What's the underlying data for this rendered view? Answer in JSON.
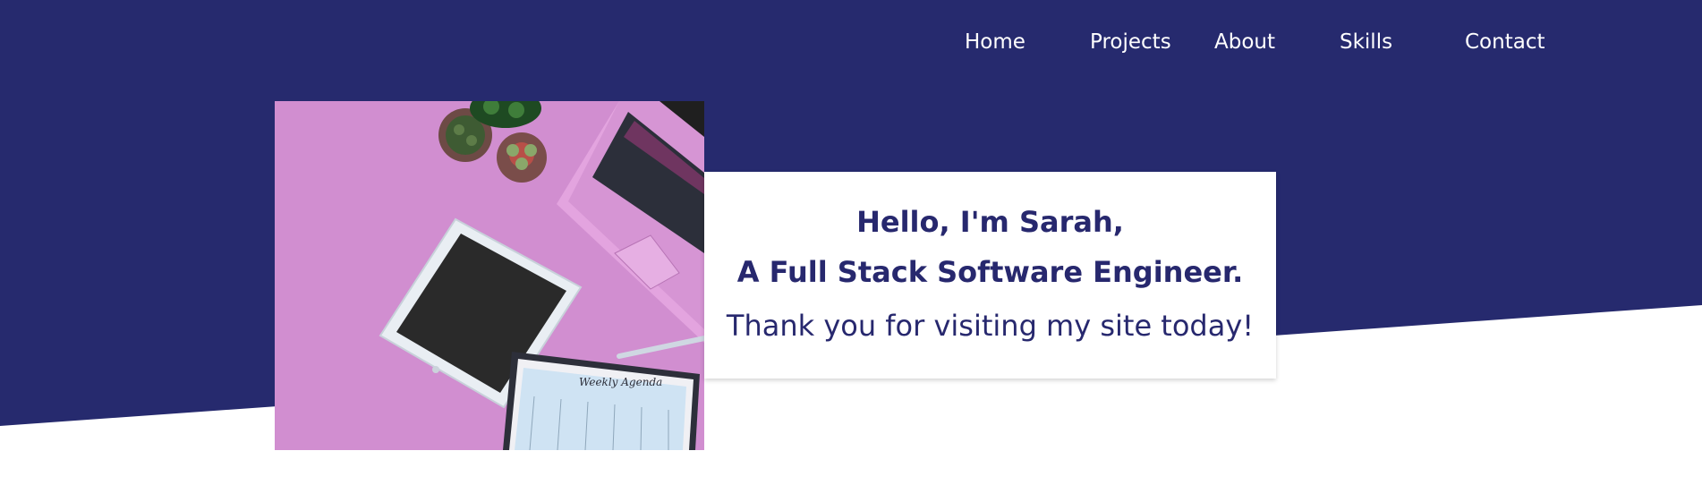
{
  "colors": {
    "hero_background": "#262a6e",
    "nav_text": "#ffffff",
    "card_text": "#27286e",
    "card_background": "#ffffff",
    "image_background": "#d18ed0"
  },
  "nav": {
    "items": [
      {
        "label": "Home",
        "icon": ""
      },
      {
        "label": "Projects",
        "icon": ""
      },
      {
        "label": "About",
        "icon": ""
      },
      {
        "label": "Skills",
        "icon": ""
      },
      {
        "label": "Contact",
        "icon": ""
      }
    ]
  },
  "hero": {
    "image_alt": "laptop, tablet, succulents and weekly agenda on pink desk",
    "image_notepad_text": "Weekly Agenda",
    "intro": {
      "greeting": "Hello, I'm Sarah,",
      "role": "A Full Stack Software Engineer.",
      "tagline": "Thank you for visiting my site today!"
    }
  }
}
